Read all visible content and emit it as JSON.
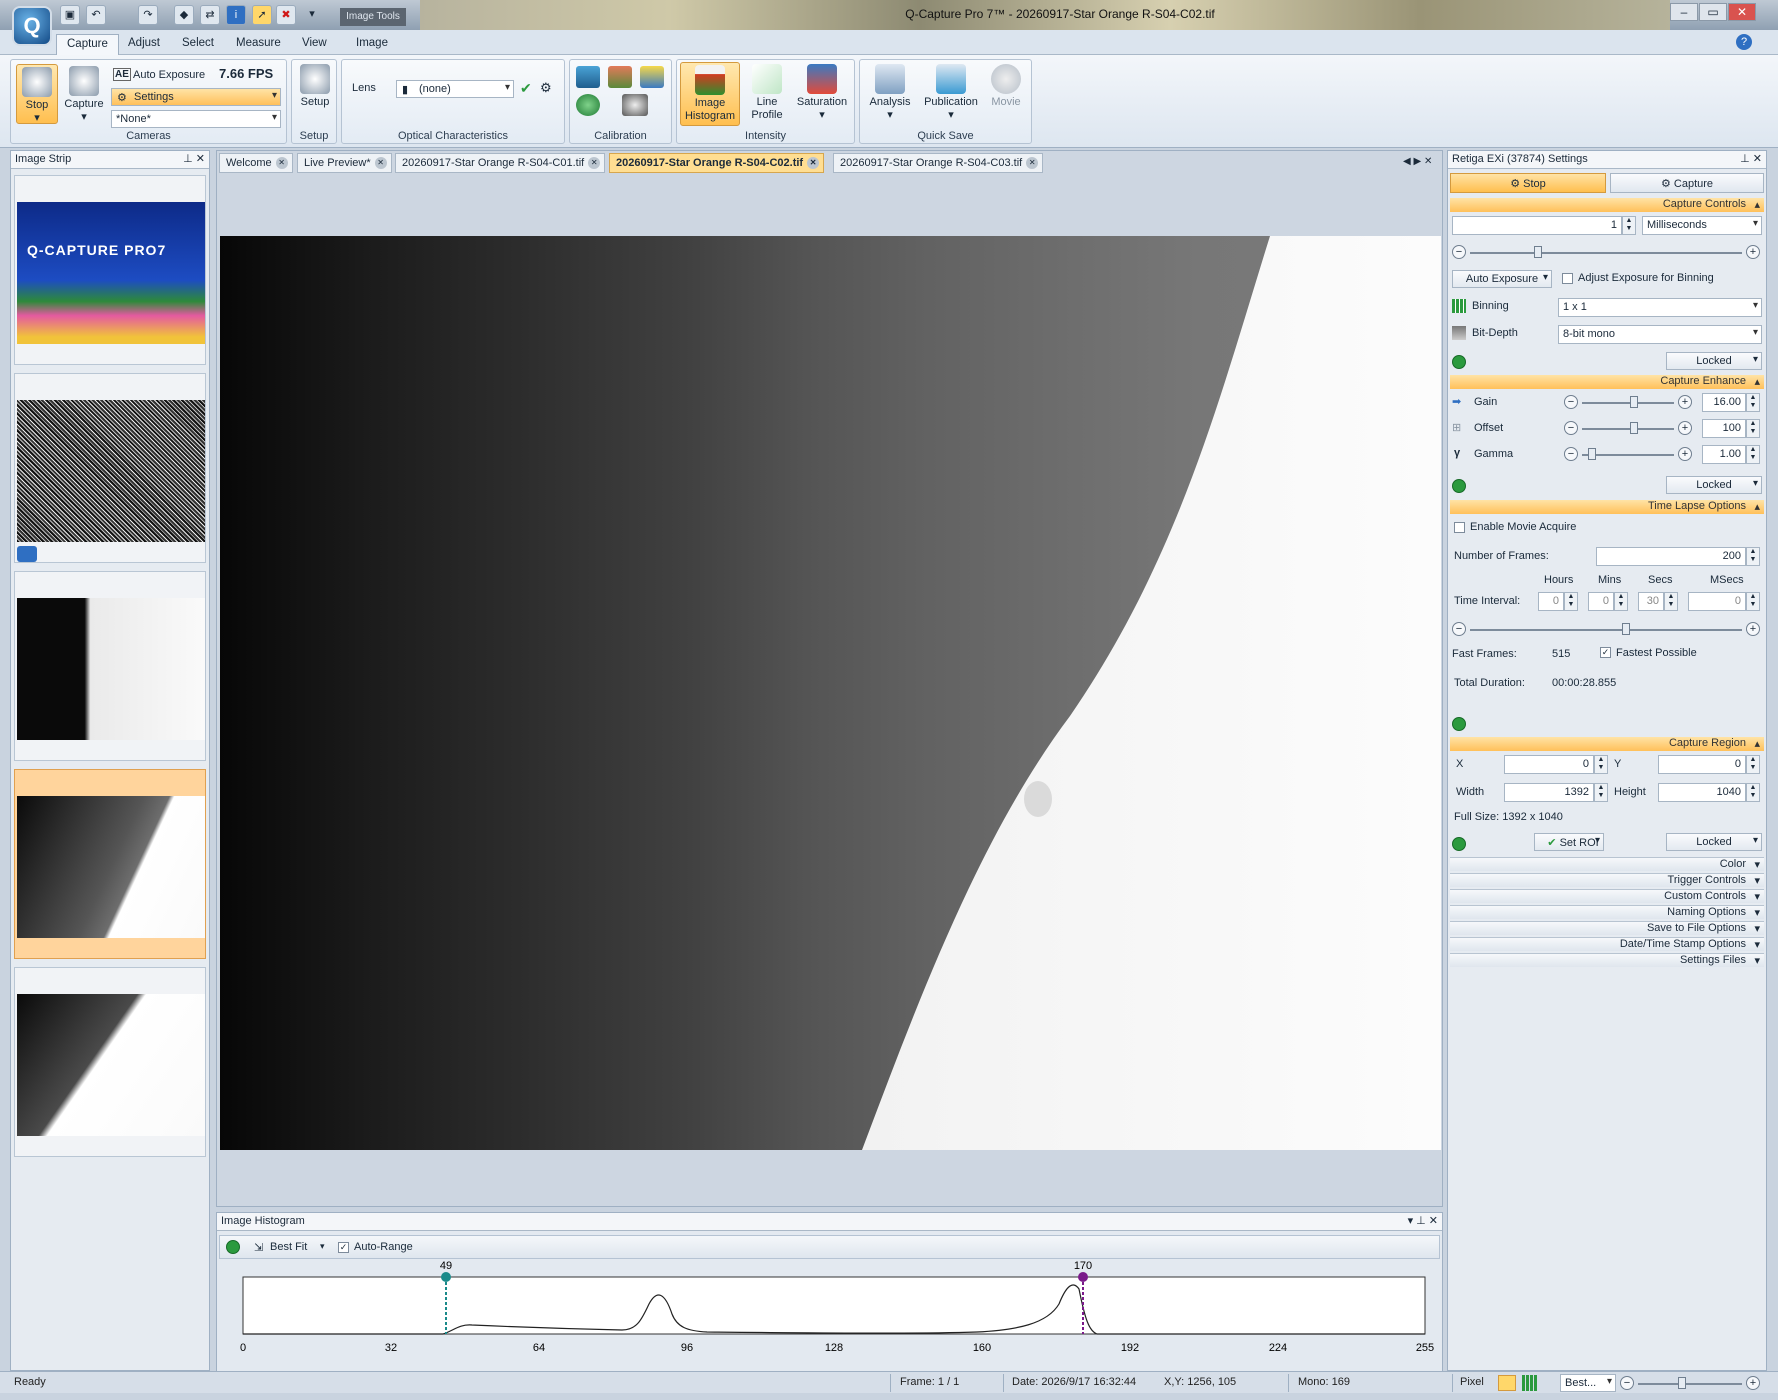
{
  "window": {
    "title": "Q-Capture Pro 7™ - 20260917-Star Orange R-S04-C02.tif",
    "contextual_tab": "Image Tools"
  },
  "menu_tabs": [
    "Capture",
    "Adjust",
    "Select",
    "Measure",
    "View",
    "Image"
  ],
  "ribbon": {
    "cameras": {
      "label": "Cameras",
      "stop": "Stop",
      "capture": "Capture",
      "auto_exposure": "Auto Exposure",
      "fps": "7.66 FPS",
      "settings": "Settings",
      "preset": "*None*"
    },
    "setup": {
      "label": "Setup",
      "button": "Setup"
    },
    "optical": {
      "label": "Optical Characteristics",
      "lens_label": "Lens",
      "lens_value": "(none)"
    },
    "calibration": {
      "label": "Calibration"
    },
    "intensity": {
      "label": "Intensity",
      "histogram": "Image Histogram",
      "line_profile": "Line Profile",
      "saturation": "Saturation"
    },
    "quick_save": {
      "label": "Quick Save",
      "analysis": "Analysis",
      "publication": "Publication",
      "movie": "Movie"
    }
  },
  "image_strip": {
    "title": "Image Strip",
    "splash_title": "Q-CAPTURE PRO7"
  },
  "doc_tabs": [
    "Welcome",
    "Live Preview*",
    "20260917-Star Orange R-S04-C01.tif",
    "20260917-Star Orange R-S04-C02.tif",
    "20260917-Star Orange R-S04-C03.tif"
  ],
  "histogram": {
    "title": "Image Histogram",
    "fit": "Best Fit",
    "auto_range": "Auto-Range",
    "marker_low": "49",
    "marker_high": "170",
    "ticks": [
      "0",
      "32",
      "64",
      "96",
      "128",
      "160",
      "192",
      "224",
      "255"
    ]
  },
  "settings_panel": {
    "title": "Retiga EXi (37874) Settings",
    "stop": "Stop",
    "capture": "Capture",
    "capture_controls": {
      "title": "Capture Controls",
      "exposure_value": "1",
      "exposure_unit": "Milliseconds",
      "auto_exposure": "Auto Exposure",
      "adjust_binning": "Adjust Exposure for Binning",
      "binning_label": "Binning",
      "binning_value": "1 x 1",
      "bitdepth_label": "Bit-Depth",
      "bitdepth_value": "8-bit mono",
      "locked": "Locked"
    },
    "capture_enhance": {
      "title": "Capture Enhance",
      "gain_label": "Gain",
      "gain_value": "16.00",
      "offset_label": "Offset",
      "offset_value": "100",
      "gamma_label": "Gamma",
      "gamma_value": "1.00",
      "locked": "Locked"
    },
    "time_lapse": {
      "title": "Time Lapse Options",
      "enable_movie": "Enable Movie Acquire",
      "frames_label": "Number of  Frames:",
      "frames_value": "200",
      "hours": "Hours",
      "mins": "Mins",
      "secs": "Secs",
      "msecs": "MSecs",
      "interval_label": "Time Interval:",
      "hours_value": "0",
      "mins_value": "0",
      "secs_value": "30",
      "msecs_value": "0",
      "fast_frames_label": "Fast Frames:",
      "fast_frames_value": "515",
      "fastest_possible": "Fastest Possible",
      "total_duration_label": "Total Duration:",
      "total_duration_value": "00:00:28.855"
    },
    "capture_region": {
      "title": "Capture Region",
      "x_label": "X",
      "x_value": "0",
      "y_label": "Y",
      "y_value": "0",
      "width_label": "Width",
      "width_value": "1392",
      "height_label": "Height",
      "height_value": "1040",
      "full_size": "Full Size: 1392 x 1040",
      "set_roi": "Set ROI",
      "locked": "Locked"
    },
    "collapsed": [
      "Color",
      "Trigger Controls",
      "Custom Controls",
      "Naming Options",
      "Save to File Options",
      "Date/Time Stamp Options",
      "Settings Files"
    ]
  },
  "status": {
    "ready": "Ready",
    "frame": "Frame: 1 / 1",
    "date": "Date: 2026/9/17 16:32:44",
    "xy": "X,Y: 1256,  105",
    "mono": "Mono:   169",
    "pixel": "Pixel",
    "zoom": "Best..."
  }
}
